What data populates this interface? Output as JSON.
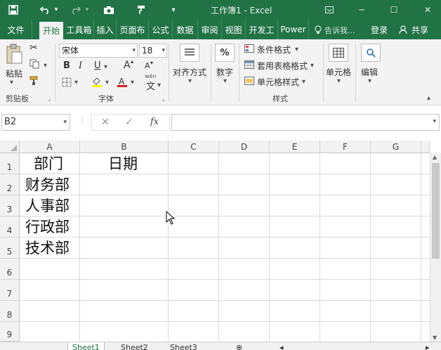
{
  "titlebar": {
    "title": "工作簿1 - Excel",
    "icons": [
      "save-icon",
      "undo-icon",
      "redo-icon",
      "camera-icon",
      "format-painter-icon"
    ]
  },
  "tabs": {
    "items": [
      "文件",
      "开始",
      "工具箱",
      "插入",
      "页面布",
      "公式",
      "数据",
      "审阅",
      "视图",
      "开发工",
      "Power"
    ],
    "active": "开始",
    "tell_me": "告诉我...",
    "login": "登录",
    "share": "共享"
  },
  "ribbon": {
    "clipboard": {
      "paste": "粘贴",
      "label": "剪贴板"
    },
    "font": {
      "name": "宋体",
      "size": "18",
      "bold": "B",
      "italic": "I",
      "underline": "U",
      "grow": "A",
      "shrink": "A",
      "label": "字体",
      "wen": "wén"
    },
    "alignment": {
      "label": "对齐方式"
    },
    "number": {
      "label": "数字",
      "symbol": "%"
    },
    "styles": {
      "conditional": "条件格式",
      "table": "套用表格格式",
      "cell": "单元格样式",
      "label": "样式"
    },
    "cells": {
      "label": "单元格"
    },
    "editing": {
      "label": "编辑"
    }
  },
  "formula_bar": {
    "name_box": "B2",
    "fx": "fx",
    "value": ""
  },
  "sheet": {
    "columns": [
      "A",
      "B",
      "C",
      "D",
      "E",
      "F",
      "G"
    ],
    "rows": [
      "1",
      "2",
      "3",
      "4",
      "5",
      "6",
      "7",
      "8",
      "9"
    ],
    "cells": {
      "A1": "部门",
      "B1": "日期",
      "A2": "财务部",
      "A3": "人事部",
      "A4": "行政部",
      "A5": "技术部"
    },
    "selected": "B2"
  },
  "sheet_tabs": {
    "items": [
      "Sheet1",
      "Sheet2",
      "Sheet3"
    ],
    "active": "Sheet1"
  },
  "colors": {
    "brand": "#217346",
    "ribbon_bg": "#f3f3f3",
    "grid_line": "#dadada"
  }
}
